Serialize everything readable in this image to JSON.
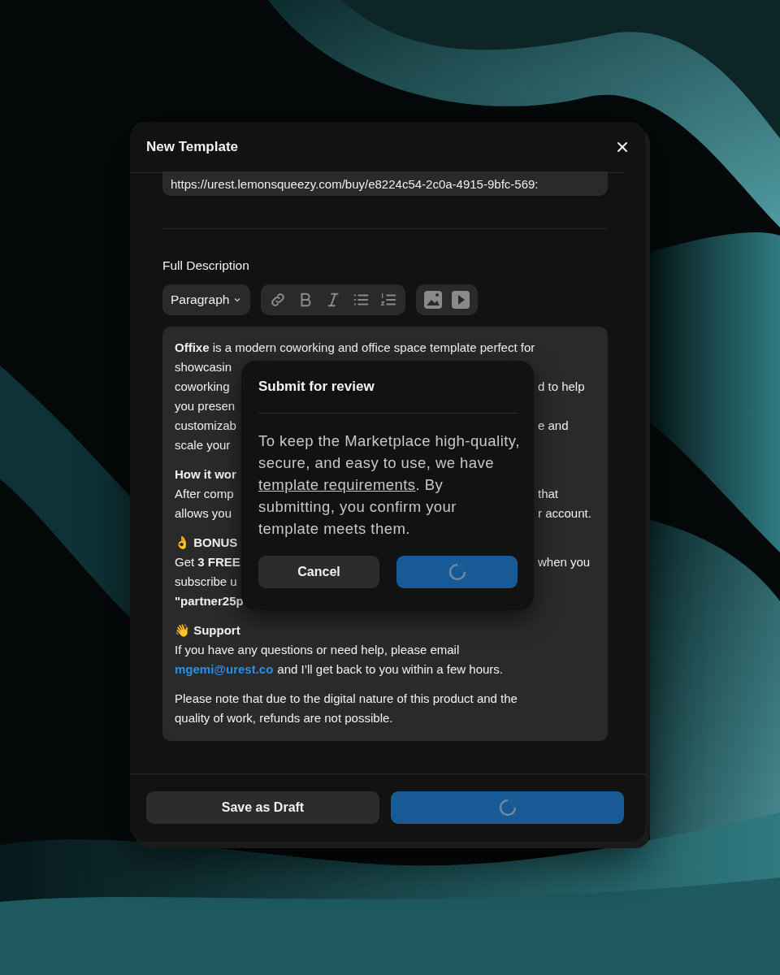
{
  "modal": {
    "title": "New Template",
    "url_field": {
      "value": "https://urest.lemonsqueezy.com/buy/e8224c54-2c0a-4915-9bfc-569:"
    },
    "description_label": "Full Description",
    "toolbar": {
      "block_style": "Paragraph"
    },
    "editor_lines": [
      {
        "left": "**Offixe** is a modern coworking and office space template perfect for",
        "kind": "text"
      },
      {
        "left": "showcasin",
        "kind": "text"
      },
      {
        "left": "coworking",
        "right": "d to help",
        "kind": "text"
      },
      {
        "left": "you presen",
        "kind": "text"
      },
      {
        "left": "customizab",
        "right": "e and",
        "kind": "text"
      },
      {
        "left": "scale your",
        "kind": "text"
      },
      {
        "left": "How it wor",
        "kind": "heading"
      },
      {
        "left": "After comp",
        "right": "that",
        "kind": "text"
      },
      {
        "left": "allows you",
        "right": "r account.",
        "kind": "text"
      },
      {
        "left": "👌 BONUS",
        "kind": "heading"
      },
      {
        "left": "Get **3 FREE**",
        "right": "when you",
        "kind": "text"
      },
      {
        "left": "subscribe u",
        "kind": "text"
      },
      {
        "left": "\"partner25p",
        "kind": "bold"
      },
      {
        "left": "👋 Support",
        "kind": "heading"
      },
      {
        "left": "If you have any questions or need help, please email",
        "kind": "text"
      },
      {
        "left": "mgemi@urest.co",
        "right": "and I’ll get back to you within a few hours.",
        "kind": "link"
      },
      {
        "left": "Please note that due to the digital nature of this product and the",
        "kind": "paragraph"
      },
      {
        "left": "quality of work, refunds are not possible.",
        "kind": "text"
      }
    ],
    "draft_button": "Save as Draft",
    "submit_loading": true
  },
  "dialog": {
    "title": "Submit for review",
    "body_before": "To keep the Marketplace high-quality, secure, and easy to use, we have",
    "link": "template requirements",
    "body_after": ". By submitting, you confirm your template meets them.",
    "cancel_button": "Cancel",
    "confirm_loading": true
  }
}
